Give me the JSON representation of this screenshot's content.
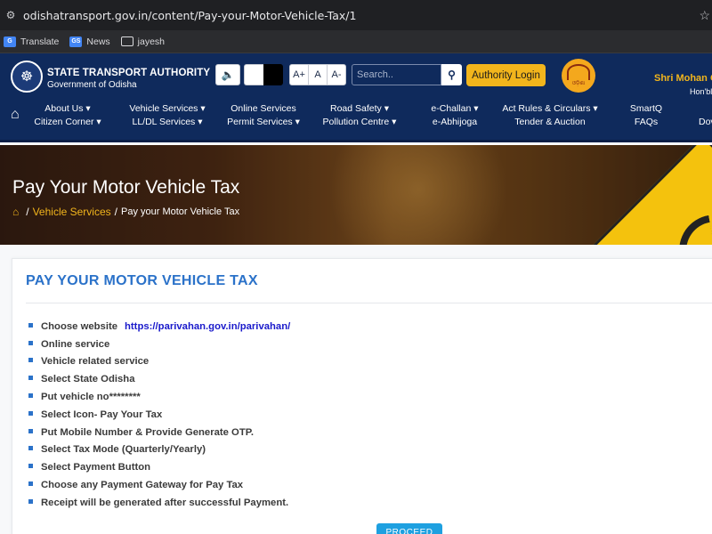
{
  "browser": {
    "url": "odishatransport.gov.in/content/Pay-your-Motor-Vehicle-Tax/1",
    "bookmarks": [
      {
        "label": "Translate",
        "icon": "translate-icon"
      },
      {
        "label": "News",
        "icon": "news-icon"
      },
      {
        "label": "jayesh",
        "icon": "folder-icon"
      }
    ]
  },
  "header": {
    "org_name": "STATE TRANSPORT AUTHORITY",
    "org_sub": "Government of Odisha",
    "font_plus": "A+",
    "font_normal": "A",
    "font_minus": "A-",
    "search_placeholder": "Search..",
    "login_label": "Authority Login",
    "logo_text": "ଓଡ଼ିଶା",
    "leader_name": "Shri Mohan Cl",
    "leader_title": "Hon'ble"
  },
  "nav": [
    {
      "top": "About Us ▾",
      "bottom": "Citizen Corner ▾"
    },
    {
      "top": "Vehicle Services ▾",
      "bottom": "LL/DL Services ▾"
    },
    {
      "top": "Online Services",
      "bottom": "Permit Services ▾"
    },
    {
      "top": "Road Safety ▾",
      "bottom": "Pollution Centre ▾"
    },
    {
      "top": "e-Challan ▾",
      "bottom": "e-Abhijoga"
    },
    {
      "top": "Act Rules & Circulars ▾",
      "bottom": "Tender & Auction"
    },
    {
      "top": "SmartQ",
      "bottom": "FAQs"
    },
    {
      "top": "",
      "bottom": "Dov"
    }
  ],
  "hero": {
    "title": "Pay Your Motor Vehicle Tax",
    "crumb_link": "Vehicle Services",
    "crumb_current": "Pay your Motor Vehicle Tax"
  },
  "content": {
    "title": "PAY YOUR MOTOR VEHICLE TAX",
    "steps": [
      {
        "text": "Choose website",
        "link": "https://parivahan.gov.in/parivahan/"
      },
      {
        "text": "Online service"
      },
      {
        "text": "Vehicle related service"
      },
      {
        "text": "Select State Odisha"
      },
      {
        "text": "Put vehicle no********"
      },
      {
        "text": "Select Icon- Pay Your Tax"
      },
      {
        "text": "Put Mobile Number & Provide Generate OTP."
      },
      {
        "text": "Select Tax Mode (Quarterly/Yearly)"
      },
      {
        "text": "Select Payment Button"
      },
      {
        "text": "Choose any Payment Gateway for Pay Tax"
      },
      {
        "text": "Receipt will be generated after successful Payment."
      }
    ],
    "proceed_label": "PROCEED"
  },
  "colors": {
    "header_bg": "#0f2a5c",
    "accent_yellow": "#f2b51c",
    "title_blue": "#2b72c9",
    "link_blue": "#1a1acb",
    "button_blue": "#1ea0e0"
  }
}
